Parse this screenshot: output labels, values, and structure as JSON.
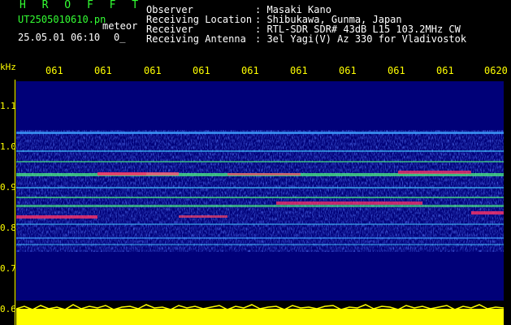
{
  "header": {
    "app_title": "H R O F F T",
    "file_name": "UT2505010610.pn",
    "meteor_label": "meteor",
    "timestamp": "25.05.01 06:10",
    "count": "0_",
    "info": [
      {
        "key": "Observer",
        "value": ": Masaki Kano"
      },
      {
        "key": "Receiving Location",
        "value": ": Shibukawa, Gunma, Japan"
      },
      {
        "key": "Receiver",
        "value": ": RTL-SDR SDR# 43dB L15 103.2MHz CW"
      },
      {
        "key": "Receiving Antenna",
        "value": ": 3el Yagi(V) Az 330 for Vladivostok"
      }
    ]
  },
  "axis": {
    "unit": "kHz",
    "time_ticks": [
      "061",
      "061",
      "061",
      "061",
      "061",
      "061",
      "061",
      "061",
      "061",
      "0620"
    ],
    "freq_ticks": [
      "1.1",
      "1.0",
      "0.9",
      "0.8",
      "0.7",
      "0.6"
    ]
  },
  "colors": {
    "background": "#000000",
    "spectrogram_bg": "#000078",
    "label": "#ffff00",
    "title": "#33ff33",
    "info": "#ffffff"
  }
}
